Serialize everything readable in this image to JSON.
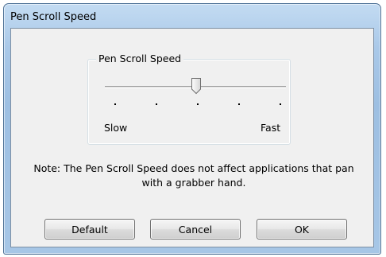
{
  "window": {
    "title": "Pen Scroll Speed"
  },
  "group": {
    "label": "Pen Scroll Speed",
    "slider": {
      "min_label": "Slow",
      "max_label": "Fast",
      "tick_count": 5,
      "value_position": 3
    }
  },
  "note": "Note: The Pen Scroll Speed does not affect applications that pan with a grabber hand.",
  "buttons": {
    "default": "Default",
    "cancel": "Cancel",
    "ok": "OK"
  },
  "icons": {
    "slider_thumb": "slider-thumb-icon"
  }
}
